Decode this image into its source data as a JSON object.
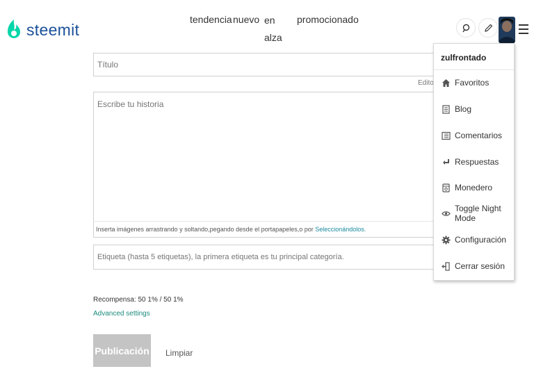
{
  "brand": {
    "name": "steemit",
    "color": "#1a5099",
    "accent": "#06d6a9"
  },
  "nav": {
    "tendencia": "tendencia",
    "nuevo": "nuevo",
    "en_alza": "en alza",
    "promocionado": "promocionado"
  },
  "header_icons": [
    "search-icon",
    "pencil-icon",
    "avatar",
    "hamburger-menu-icon"
  ],
  "editor": {
    "title_placeholder": "Título",
    "editor_label": "Editor",
    "body_placeholder": "Escribe tu historia",
    "dropzone_text": "Inserta imágenes arrastrando y soltando,pegando desde el portapapeles,o por ",
    "dropzone_link": "Seleccionándolos.",
    "tags_placeholder": "Etiqueta (hasta 5 etiquetas), la primera etiqueta es tu principal categoría.",
    "reward": "Recompensa: 50 1% / 50 1%",
    "advanced": "Advanced settings",
    "publish": "Publicación",
    "clear": "Limpiar"
  },
  "dropdown": {
    "username": "zulfrontado",
    "items": [
      {
        "label": "Favoritos",
        "icon": "home-icon"
      },
      {
        "label": "Blog",
        "icon": "blog-icon"
      },
      {
        "label": "Comentarios",
        "icon": "comments-icon"
      },
      {
        "label": "Respuestas",
        "icon": "reply-icon"
      },
      {
        "label": "Monedero",
        "icon": "wallet-icon"
      },
      {
        "label": "Toggle Night Mode",
        "icon": "eye-icon"
      },
      {
        "label": "Configuración",
        "icon": "gear-icon"
      },
      {
        "label": "Cerrar sesión",
        "icon": "logout-icon"
      }
    ]
  }
}
